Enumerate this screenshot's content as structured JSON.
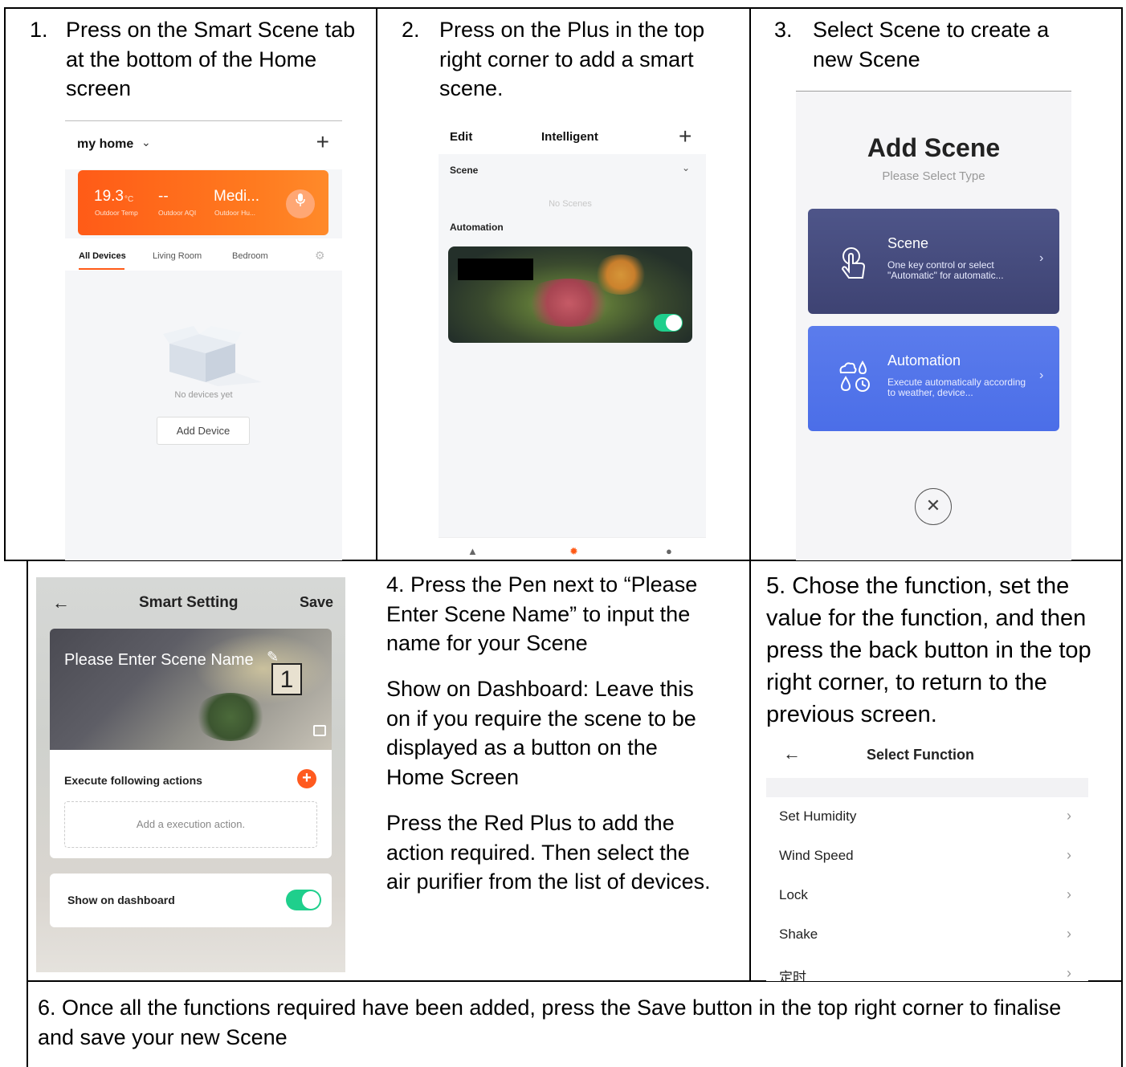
{
  "steps": {
    "s1": {
      "num": "1.",
      "text": "Press on the Smart Scene tab at the bottom of the Home screen"
    },
    "s2": {
      "num": "2.",
      "text": "Press on the Plus in the top right corner to add a smart scene."
    },
    "s3": {
      "num": "3.",
      "text": "Select Scene to create a new Scene"
    },
    "s4": {
      "p1": "4. Press the Pen next to “Please Enter Scene Name” to input the name for your Scene",
      "p2": "Show on Dashboard: Leave this on if you require the scene to be displayed as a button on the Home Screen",
      "p3": "Press the Red Plus to add the action required.  Then select the air purifier from the list of devices."
    },
    "s5": {
      "text": "5. Chose the function, set the value for the function, and then press the back button in the top right corner, to return to the previous screen."
    },
    "s6": {
      "text": "6.  Once all the functions required have been added, press the Save button in the top right corner to finalise and save your new Scene"
    }
  },
  "screen_home": {
    "home_name": "my home",
    "weather": {
      "temp": "19.3",
      "temp_unit": "°C",
      "aqi": "--",
      "humidity": "Medi...",
      "temp_label": "Outdoor Temp",
      "aqi_label": "Outdoor AQI",
      "humidity_label": "Outdoor Hu..."
    },
    "tabs": [
      "All Devices",
      "Living Room",
      "Bedroom"
    ],
    "empty_text": "No devices yet",
    "add_device": "Add Device"
  },
  "screen_intelligent": {
    "edit": "Edit",
    "title": "Intelligent",
    "scene_label": "Scene",
    "no_scenes": "No Scenes",
    "automation_label": "Automation"
  },
  "screen_add_scene": {
    "title": "Add Scene",
    "subtitle": "Please Select Type",
    "options": [
      {
        "title": "Scene",
        "desc": "One key control or select \"Automatic\" for automatic..."
      },
      {
        "title": "Automation",
        "desc": "Execute automatically according to weather, device..."
      }
    ]
  },
  "screen_smart_setting": {
    "title": "Smart Setting",
    "save": "Save",
    "scene_name_placeholder": "Please Enter Scene Name",
    "frame_number": "1",
    "execute_label": "Execute following actions",
    "add_action": "Add a execution action.",
    "show_dashboard": "Show on dashboard"
  },
  "screen_select_function": {
    "title": "Select Function",
    "items": [
      "Set Humidity",
      "Wind Speed",
      "Lock",
      "Shake",
      "定时"
    ]
  },
  "colors": {
    "accent_orange": "#ff5b17",
    "toggle_green": "#1fcf8c",
    "scene_card": "#474d80",
    "automation_card": "#5575ea"
  }
}
